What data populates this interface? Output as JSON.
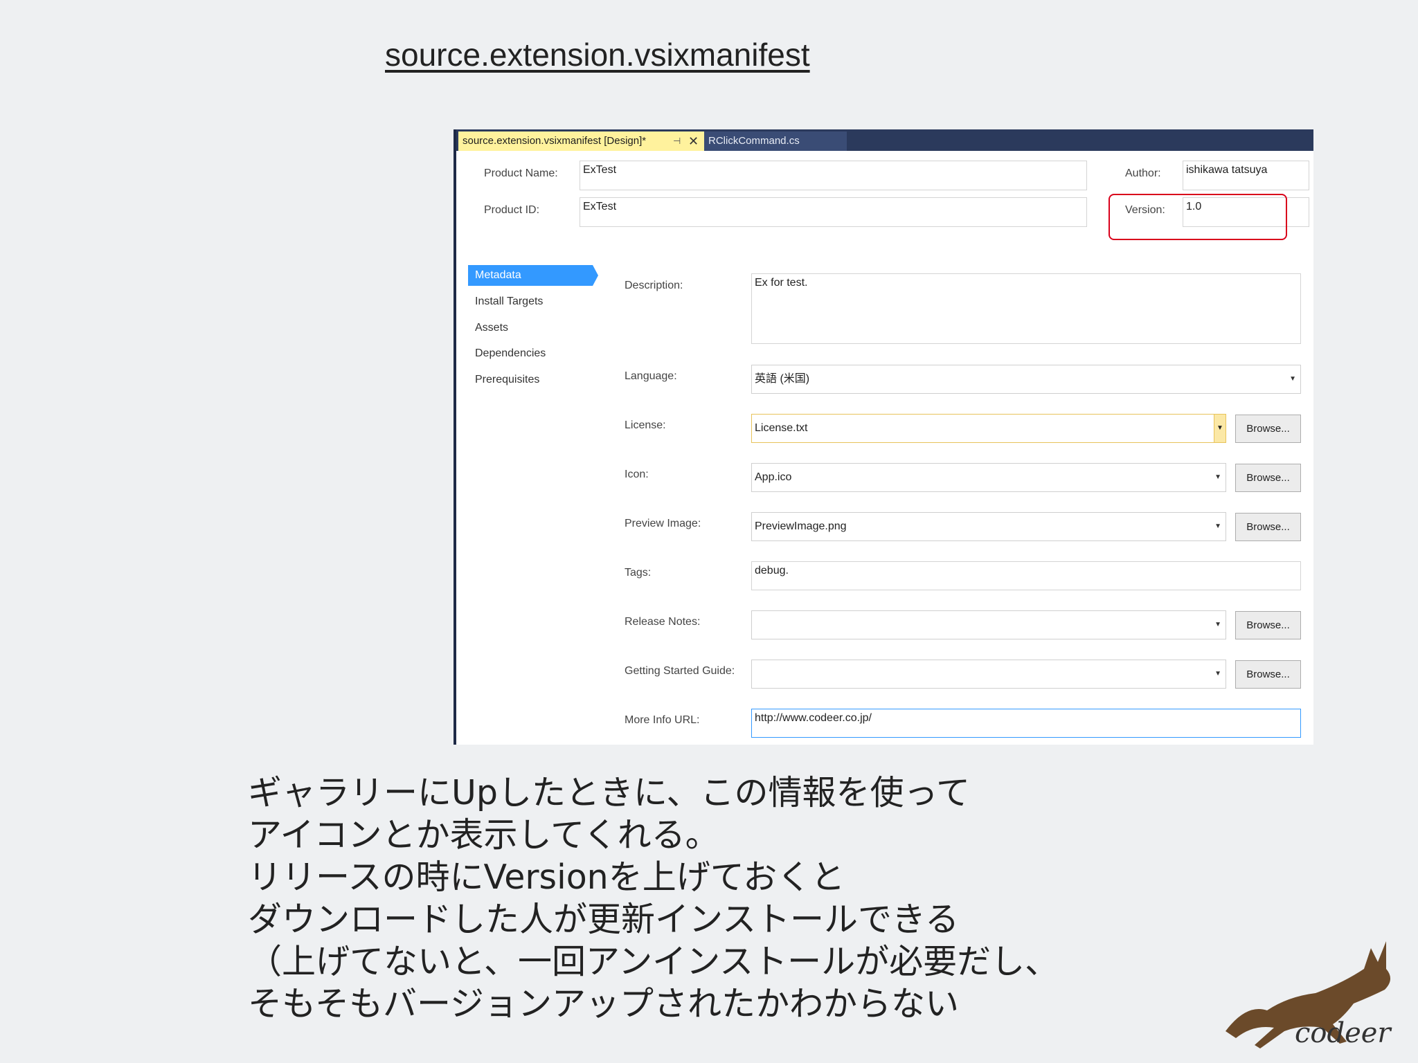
{
  "slide": {
    "title": "source.extension.vsixmanifest"
  },
  "tabs": {
    "active": "source.extension.vsixmanifest [Design]*",
    "inactive": "RClickCommand.cs"
  },
  "header": {
    "product_name_label": "Product Name:",
    "product_name_value": "ExTest",
    "product_id_label": "Product ID:",
    "product_id_value": "ExTest",
    "author_label": "Author:",
    "author_value": "ishikawa tatsuya",
    "version_label": "Version:",
    "version_value": "1.0"
  },
  "nav": {
    "items": [
      {
        "label": "Metadata"
      },
      {
        "label": "Install Targets"
      },
      {
        "label": "Assets"
      },
      {
        "label": "Dependencies"
      },
      {
        "label": "Prerequisites"
      }
    ]
  },
  "fields": {
    "description_label": "Description:",
    "description_value": "Ex for test.",
    "language_label": "Language:",
    "language_value": "英語 (米国)",
    "license_label": "License:",
    "license_value": "License.txt",
    "icon_label": "Icon:",
    "icon_value": "App.ico",
    "preview_label": "Preview Image:",
    "preview_value": "PreviewImage.png",
    "tags_label": "Tags:",
    "tags_value": "debug.",
    "release_label": "Release Notes:",
    "release_value": "",
    "guide_label": "Getting Started Guide:",
    "guide_value": "",
    "url_label": "More Info URL:",
    "url_value": "http://www.codeer.co.jp/",
    "browse_label": "Browse..."
  },
  "caption": {
    "line1": "ギャラリーにUpしたときに、この情報を使って",
    "line2": "アイコンとか表示してくれる。",
    "line3": "リリースの時にVersionを上げておくと",
    "line4": "ダウンロードした人が更新インストールできる",
    "line5": "（上げてないと、一回アンインストールが必要だし、",
    "line6": "そもそもバージョンアップされたかわからない"
  },
  "brand": {
    "logo_text": "codeer"
  },
  "colors": {
    "tab_active": "#fff29d",
    "tab_bar": "#2b3a5c",
    "nav_selected": "#3399ff",
    "highlight": "#d9001b"
  }
}
